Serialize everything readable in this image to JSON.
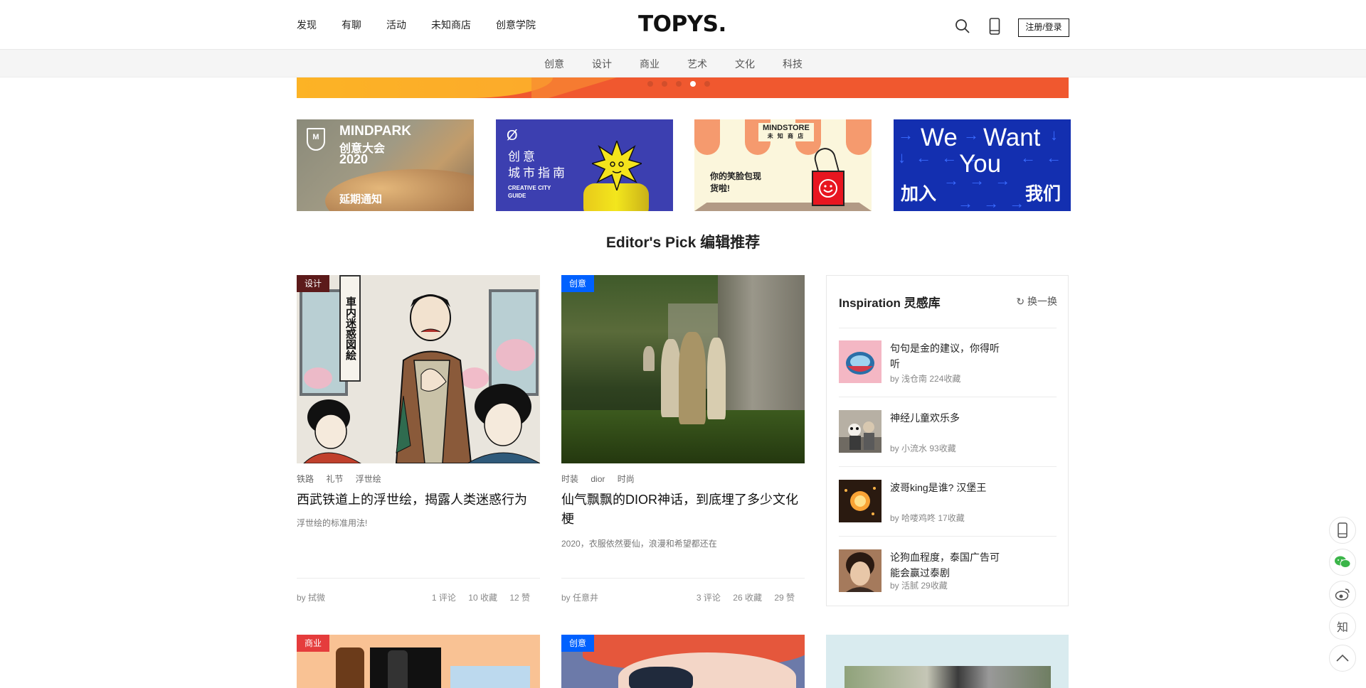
{
  "header": {
    "nav": [
      "发现",
      "有聊",
      "活动",
      "未知商店",
      "创意学院"
    ],
    "logo": "TOPYS.",
    "login_label": "注册/登录",
    "icons": [
      "search-icon",
      "phone-icon"
    ]
  },
  "subnav": [
    "创意",
    "设计",
    "商业",
    "艺术",
    "文化",
    "科技"
  ],
  "carousel": {
    "dots": 5,
    "active_index": 3
  },
  "promos": [
    {
      "line1": "MINDPARK",
      "line2": "创意大会",
      "line3": "2020",
      "line4": "延期通知",
      "badge": "M"
    },
    {
      "symbol": "Ø",
      "line1": "创意",
      "line2": "城市指南",
      "line3": "CREATIVE CITY GUIDE"
    },
    {
      "brand": "MINDSTORE",
      "brand_sub": "未 知 商 店",
      "message": "你的笑脸包现货啦!"
    },
    {
      "w1": "We",
      "w2": "Want",
      "w3": "You",
      "c1": "加入",
      "c2": "我们"
    }
  ],
  "section_title": "Editor's Pick 编辑推荐",
  "articles": [
    {
      "tag": "设计",
      "sign_text": "車内迷惑図絵",
      "keywords": [
        "铁路",
        "礼节",
        "浮世绘"
      ],
      "title": "西武铁道上的浮世绘，揭露人类迷惑行为",
      "desc": "浮世绘的标准用法!",
      "author": "by 拭微",
      "comments": "1 评论",
      "favorites": "10 收藏",
      "likes": "12 赞"
    },
    {
      "tag": "创意",
      "keywords": [
        "时装",
        "dior",
        "时尚"
      ],
      "title": "仙气飘飘的DIOR神话，到底埋了多少文化梗",
      "desc": "2020，衣服依然要仙，浪漫和希望都还在",
      "author": "by 任意井",
      "comments": "3 评论",
      "favorites": "26 收藏",
      "likes": "29 赞"
    }
  ],
  "inspiration": {
    "title": "Inspiration 灵感库",
    "refresh_label": "换一换",
    "items": [
      {
        "title": "句句是金的建议，你得听听",
        "meta": "by 浅仓南 224收藏"
      },
      {
        "title": "神经儿童欢乐多",
        "meta": "by 小流水 93收藏"
      },
      {
        "title": "波哥king是谁? 汉堡王",
        "meta": "by 哈喽鸡咚 17收藏"
      },
      {
        "title": "论狗血程度，泰国广告可能会赢过泰剧",
        "meta": "by 活腻 29收藏"
      }
    ]
  },
  "bottom_cards": [
    {
      "tag": "商业"
    },
    {
      "tag": "创意"
    },
    {
      "tag": ""
    }
  ],
  "side_buttons": [
    "phone-icon",
    "wechat-icon",
    "weibo-icon",
    "zhihu-icon",
    "back-to-top-icon"
  ],
  "side_zhihu_label": "知"
}
